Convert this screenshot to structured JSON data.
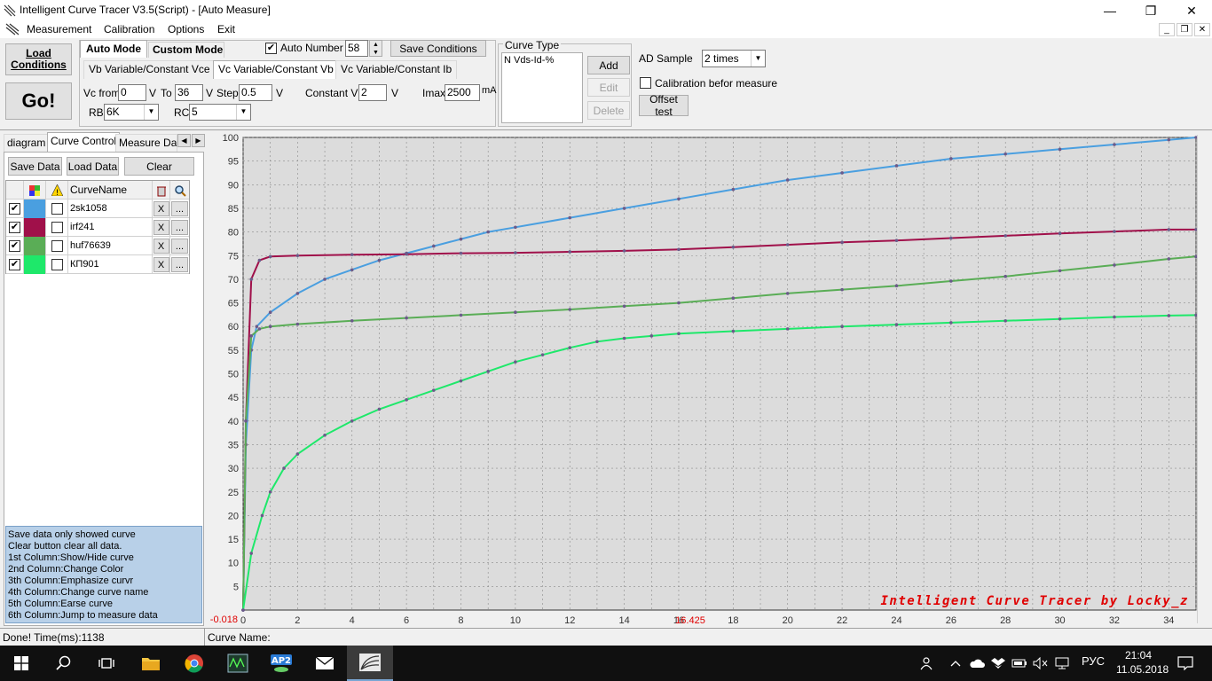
{
  "window": {
    "title": "Intelligent Curve Tracer V3.5(Script) - [Auto Measure]"
  },
  "menu": {
    "items": [
      "Measurement",
      "Calibration",
      "Options",
      "Exit"
    ]
  },
  "toolbar": {
    "load_conditions": "Load\nConditions",
    "go": "Go!",
    "tab_auto": "Auto Mode",
    "tab_custom": "Custom Mode",
    "auto_number_label": "Auto Number",
    "auto_number_value": "58",
    "save_conditions": "Save Conditions",
    "subtabs": [
      "Vb Variable/Constant Vce",
      "Vc Variable/Constant Vb",
      "Vc Variable/Constant Ib"
    ],
    "vc_from_label": "Vc from",
    "vc_from_value": "0",
    "v1": "V",
    "to_label": "To",
    "to_value": "36",
    "v2": "V",
    "step_label": "Step",
    "step_value": "0.5",
    "v3": "V",
    "constant_vb_label": "Constant Vb",
    "constant_vb_value": "2",
    "v4": "V",
    "imax_label": "Imax",
    "imax_value": "2500",
    "ma": "mA",
    "rb_label": "RB",
    "rb_value": "6K",
    "rc_label": "RC",
    "rc_value": "5",
    "curve_type_label": "Curve Type",
    "curve_type_item": "N Vds-Id-%",
    "add": "Add",
    "edit": "Edit",
    "delete": "Delete",
    "ad_sample_label": "AD Sample",
    "ad_sample_value": "2 times",
    "calibration_label": "Calibration befor measure",
    "offset_test": "Offset test"
  },
  "left": {
    "tabs": [
      "diagram",
      "Curve Control",
      "Measure Data"
    ],
    "save_data": "Save Data",
    "load_data": "Load Data",
    "clear": "Clear",
    "column_curve_name": "CurveName",
    "curves": [
      {
        "name": "2sk1058",
        "color": "#4a9fe0",
        "shown": true
      },
      {
        "name": "irf241",
        "color": "#a0104a",
        "shown": true
      },
      {
        "name": "huf76639",
        "color": "#5aad56",
        "shown": true
      },
      {
        "name": "КП901",
        "color": "#1ee86a",
        "shown": true
      }
    ],
    "row_x": "X",
    "row_more": "...",
    "help": [
      "   Save data only showed curve",
      "   Clear button clear all data.",
      "1st Column:Show/Hide curve",
      "2nd Column:Change Color",
      "3th Column:Emphasize curvr",
      "4th Column:Change curve name",
      "5th Column:Earse curve",
      "6th Column:Jump to measure data"
    ]
  },
  "status": {
    "left": "Done!  Time(ms):1138",
    "right": "Curve Name:"
  },
  "taskbar": {
    "lang": "РУС",
    "time": "21:04",
    "date": "11.05.2018"
  },
  "chart_data": {
    "type": "line",
    "watermark": "Intelligent Curve Tracer by Locky_z",
    "cursor_x_label": "16.425",
    "y_min_label": "-0.018",
    "xlim": [
      0,
      35
    ],
    "ylim": [
      0,
      100
    ],
    "x_ticks": [
      0,
      2,
      4,
      6,
      8,
      10,
      12,
      14,
      16,
      18,
      20,
      22,
      24,
      26,
      28,
      30,
      32,
      34
    ],
    "y_ticks": [
      5,
      10,
      15,
      20,
      25,
      30,
      35,
      40,
      45,
      50,
      55,
      60,
      65,
      70,
      75,
      80,
      85,
      90,
      95,
      100
    ],
    "grid": true,
    "series": [
      {
        "name": "2sk1058",
        "color": "#4a9fe0",
        "x": [
          0,
          0.1,
          0.3,
          0.5,
          1,
          2,
          3,
          4,
          5,
          6,
          7,
          8,
          9,
          10,
          12,
          14,
          16,
          18,
          20,
          22,
          24,
          26,
          28,
          30,
          32,
          34,
          35
        ],
        "y": [
          0,
          35,
          55,
          60,
          63,
          67,
          70,
          72,
          74,
          75.5,
          77,
          78.5,
          80,
          81,
          83,
          85,
          87,
          89,
          91,
          92.5,
          94,
          95.5,
          96.5,
          97.5,
          98.5,
          99.5,
          100
        ]
      },
      {
        "name": "irf241",
        "color": "#a0104a",
        "x": [
          0,
          0.1,
          0.3,
          0.6,
          1,
          2,
          4,
          6,
          8,
          10,
          12,
          14,
          16,
          18,
          20,
          22,
          24,
          26,
          28,
          30,
          32,
          34,
          35
        ],
        "y": [
          0,
          40,
          70,
          74,
          74.8,
          75,
          75.2,
          75.3,
          75.5,
          75.6,
          75.8,
          76,
          76.3,
          76.8,
          77.3,
          77.8,
          78.2,
          78.7,
          79.2,
          79.7,
          80.1,
          80.5,
          80.5
        ]
      },
      {
        "name": "huf76639",
        "color": "#5aad56",
        "x": [
          0,
          0.1,
          0.3,
          0.6,
          1,
          2,
          4,
          6,
          8,
          10,
          12,
          14,
          16,
          18,
          20,
          22,
          24,
          26,
          28,
          30,
          32,
          34,
          35
        ],
        "y": [
          0,
          40,
          58,
          59.5,
          60,
          60.5,
          61.2,
          61.8,
          62.4,
          63,
          63.6,
          64.3,
          65,
          66,
          67,
          67.8,
          68.6,
          69.6,
          70.6,
          71.8,
          73,
          74.3,
          74.8
        ]
      },
      {
        "name": "КП901",
        "color": "#1ee86a",
        "x": [
          0,
          0.3,
          0.7,
          1,
          1.5,
          2,
          3,
          4,
          5,
          6,
          7,
          8,
          9,
          10,
          11,
          12,
          13,
          14,
          15,
          16,
          18,
          20,
          22,
          24,
          26,
          28,
          30,
          32,
          34,
          35
        ],
        "y": [
          0,
          12,
          20,
          25,
          30,
          33,
          37,
          40,
          42.5,
          44.5,
          46.5,
          48.5,
          50.5,
          52.5,
          54,
          55.5,
          56.8,
          57.5,
          58,
          58.5,
          59,
          59.5,
          60,
          60.4,
          60.8,
          61.2,
          61.6,
          62,
          62.3,
          62.4
        ]
      }
    ]
  }
}
